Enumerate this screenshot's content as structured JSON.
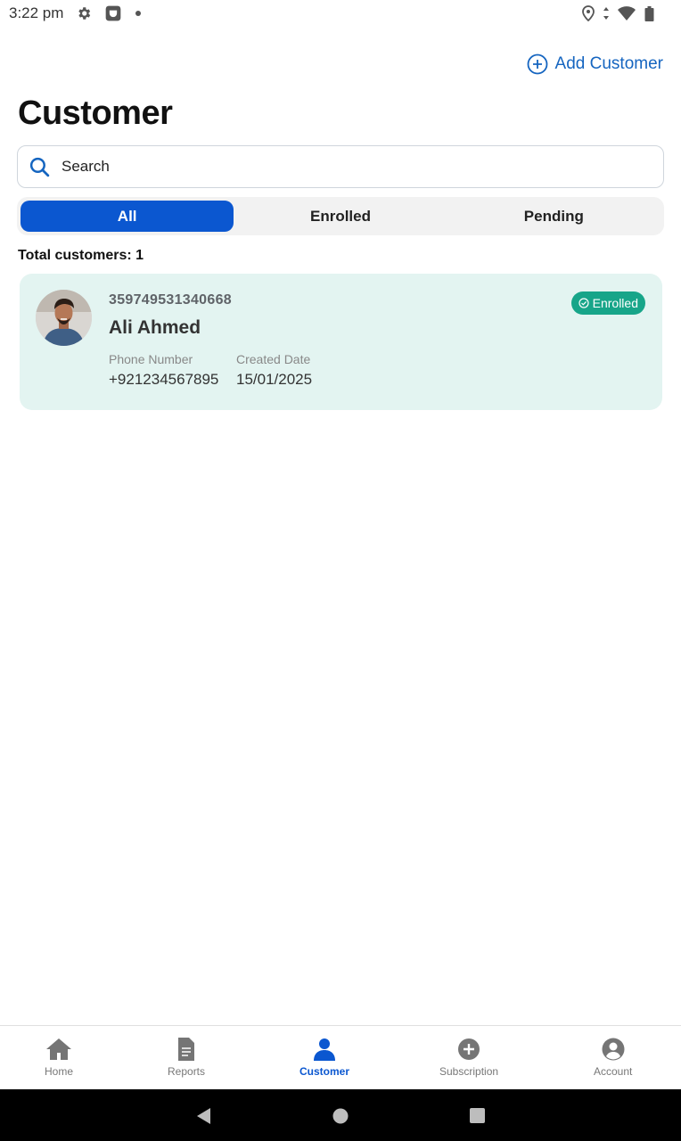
{
  "status_bar": {
    "time": "3:22 pm"
  },
  "header": {
    "add_customer_label": "Add Customer",
    "title": "Customer"
  },
  "search": {
    "placeholder": "Search"
  },
  "tabs": [
    {
      "label": "All",
      "active": true
    },
    {
      "label": "Enrolled",
      "active": false
    },
    {
      "label": "Pending",
      "active": false
    }
  ],
  "total_label": "Total customers: 1",
  "customers": [
    {
      "id": "359749531340668",
      "name": "Ali Ahmed",
      "status": "Enrolled",
      "phone_label": "Phone Number",
      "phone": "+921234567895",
      "date_label": "Created Date",
      "created_date": "15/01/2025"
    }
  ],
  "bottom_nav": [
    {
      "label": "Home",
      "icon": "home-icon",
      "active": false
    },
    {
      "label": "Reports",
      "icon": "document-icon",
      "active": false
    },
    {
      "label": "Customer",
      "icon": "person-icon",
      "active": true
    },
    {
      "label": "Subscription",
      "icon": "plus-circle-icon",
      "active": false
    },
    {
      "label": "Account",
      "icon": "account-circle-icon",
      "active": false
    }
  ],
  "colors": {
    "primary": "#0b57d0",
    "link": "#1565c0",
    "card_bg": "#e3f4f1",
    "badge": "#17a589"
  }
}
